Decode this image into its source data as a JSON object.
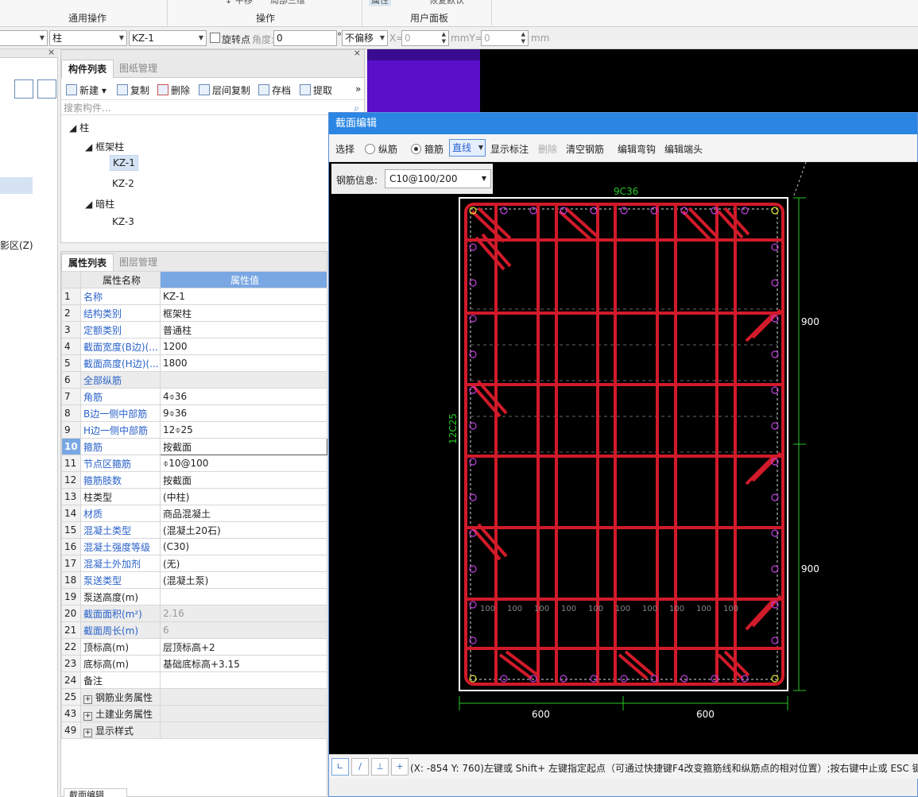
{
  "ribbon": {
    "groups": [
      "通用操作",
      "操作",
      "用户面板"
    ],
    "partial_buttons": [
      "平移",
      "局部三维",
      "属性",
      "恢复默认"
    ]
  },
  "toolbar2": {
    "combo1_value": "",
    "element_type": "柱",
    "element_name": "KZ-1",
    "rotate_point_label": "旋转点",
    "angle_label": "角度:",
    "angle_value": "0",
    "degree_symbol": "°",
    "offset_value": "不偏移",
    "x_label": "X=",
    "x_value": "0",
    "y_label": "mmY=",
    "y_value": "0",
    "mm_label": "mm"
  },
  "left_panel": {
    "visible_text": "影区(Z)"
  },
  "component_panel": {
    "tabs": [
      "构件列表",
      "图纸管理"
    ],
    "buttons": [
      "新建",
      "复制",
      "删除",
      "层间复制",
      "存档",
      "提取"
    ],
    "more": "»",
    "search_placeholder": "搜索构件...",
    "tree": [
      {
        "label": "柱",
        "level": 0,
        "expanded": true
      },
      {
        "label": "框架柱",
        "level": 1,
        "expanded": true
      },
      {
        "label": "KZ-1",
        "level": 2,
        "selected": true
      },
      {
        "label": "KZ-2",
        "level": 2
      },
      {
        "label": "暗柱",
        "level": 1,
        "expanded": true
      },
      {
        "label": "KZ-3",
        "level": 2
      }
    ]
  },
  "property_panel": {
    "tabs": [
      "属性列表",
      "图层管理"
    ],
    "col_name": "属性名称",
    "col_value": "属性值",
    "rows": [
      {
        "n": "1",
        "k": "名称",
        "v": "KZ-1",
        "blue": true
      },
      {
        "n": "2",
        "k": "结构类别",
        "v": "框架柱",
        "blue": true
      },
      {
        "n": "3",
        "k": "定额类别",
        "v": "普通柱",
        "blue": true
      },
      {
        "n": "4",
        "k": "截面宽度(B边)(...",
        "v": "1200",
        "blue": true
      },
      {
        "n": "5",
        "k": "截面高度(H边)(...",
        "v": "1800",
        "blue": true
      },
      {
        "n": "6",
        "k": "全部纵筋",
        "v": "",
        "blue": true,
        "shaded": true
      },
      {
        "n": "7",
        "k": "角筋",
        "v": "4⌽36",
        "blue": true
      },
      {
        "n": "8",
        "k": "B边一侧中部筋",
        "v": "9⌽36",
        "blue": true
      },
      {
        "n": "9",
        "k": "H边一侧中部筋",
        "v": "12⌽25",
        "blue": true
      },
      {
        "n": "10",
        "k": "箍筋",
        "v": "按截面",
        "blue": true,
        "current": true
      },
      {
        "n": "11",
        "k": "节点区箍筋",
        "v": "⌽10@100",
        "blue": true
      },
      {
        "n": "12",
        "k": "箍筋肢数",
        "v": "按截面",
        "blue": true
      },
      {
        "n": "13",
        "k": "柱类型",
        "v": "(中柱)",
        "blue": false
      },
      {
        "n": "14",
        "k": "材质",
        "v": "商品混凝土",
        "blue": true
      },
      {
        "n": "15",
        "k": "混凝土类型",
        "v": "(混凝土20石)",
        "blue": true
      },
      {
        "n": "16",
        "k": "混凝土强度等级",
        "v": "(C30)",
        "blue": true
      },
      {
        "n": "17",
        "k": "混凝土外加剂",
        "v": "(无)",
        "blue": true
      },
      {
        "n": "18",
        "k": "泵送类型",
        "v": "(混凝土泵)",
        "blue": true
      },
      {
        "n": "19",
        "k": "泵送高度(m)",
        "v": "",
        "blue": false
      },
      {
        "n": "20",
        "k": "截面面积(m²)",
        "v": "2.16",
        "blue": true,
        "gray": true,
        "shaded": true
      },
      {
        "n": "21",
        "k": "截面周长(m)",
        "v": "6",
        "blue": true,
        "gray": true,
        "shaded": true
      },
      {
        "n": "22",
        "k": "顶标高(m)",
        "v": "层顶标高+2",
        "blue": false
      },
      {
        "n": "23",
        "k": "底标高(m)",
        "v": "基础底标高+3.15",
        "blue": false
      },
      {
        "n": "24",
        "k": "备注",
        "v": "",
        "blue": false
      },
      {
        "n": "25",
        "k": "钢筋业务属性",
        "v": "",
        "expand": true,
        "shaded": true
      },
      {
        "n": "43",
        "k": "土建业务属性",
        "v": "",
        "expand": true,
        "shaded": true
      },
      {
        "n": "49",
        "k": "显示样式",
        "v": "",
        "expand": true,
        "shaded": true
      }
    ]
  },
  "dialog": {
    "title": "截面编辑",
    "tools": {
      "select": "选择",
      "longitudinal": "纵筋",
      "stirrup": "箍筋",
      "line_mode": "直线",
      "show_label": "显示标注",
      "delete": "删除",
      "clear": "清空钢筋",
      "edit_hook": "编辑弯钩",
      "edit_end": "编辑端头"
    },
    "rebar_info_label": "钢筋信息:",
    "rebar_info_value": "C10@100/200",
    "drawing": {
      "top_label": "9C36",
      "left_label": "12C25",
      "right_dims": [
        "900",
        "900"
      ],
      "bottom_dims": [
        "600",
        "600"
      ],
      "spacing_labels": [
        "100",
        "100",
        "100",
        "100",
        "100",
        "100",
        "100",
        "100",
        "100",
        "100"
      ]
    },
    "status_text": "(X: -854 Y: 760)左键或 Shift+ 左键指定起点（可通过快捷键F4改变箍筋线和纵筋点的相对位置）;按右键中止或 ESC 键取消"
  },
  "bottom_tab": "截面编辑",
  "colors": {
    "accent": "#2b86e3",
    "header_value": "#79a7e3",
    "rebar": "#d11a2a",
    "dim": "#26c926",
    "link_text": "#2a62c9"
  }
}
